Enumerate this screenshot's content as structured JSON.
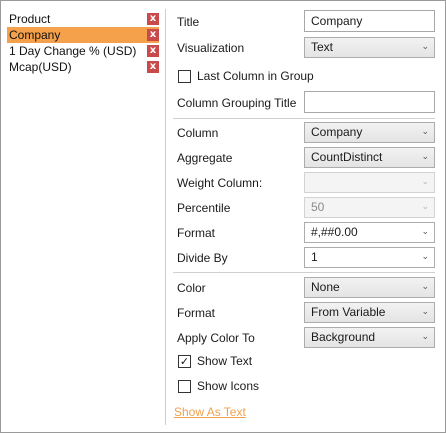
{
  "columns": [
    {
      "label": "Product",
      "selected": false
    },
    {
      "label": "Company",
      "selected": true
    },
    {
      "label": "1 Day Change % (USD)",
      "selected": false
    },
    {
      "label": "Mcap(USD)",
      "selected": false
    }
  ],
  "remove_glyph": "x",
  "title": {
    "label": "Title",
    "value": "Company"
  },
  "visualization": {
    "label": "Visualization",
    "value": "Text"
  },
  "last_column": {
    "label": "Last Column in Group",
    "checked": false
  },
  "grouping_title": {
    "label": "Column Grouping Title",
    "value": ""
  },
  "column": {
    "label": "Column",
    "value": "Company"
  },
  "aggregate": {
    "label": "Aggregate",
    "value": "CountDistinct"
  },
  "weight_column": {
    "label": "Weight Column:",
    "value": ""
  },
  "percentile": {
    "label": "Percentile",
    "value": "50"
  },
  "format": {
    "label": "Format",
    "value": "#,##0.00"
  },
  "divide_by": {
    "label": "Divide By",
    "value": "1"
  },
  "color": {
    "label": "Color",
    "value": "None"
  },
  "color_format": {
    "label": "Format",
    "value": "From Variable"
  },
  "apply_color_to": {
    "label": "Apply Color To",
    "value": "Background"
  },
  "show_text": {
    "label": "Show Text",
    "checked": true
  },
  "show_icons": {
    "label": "Show Icons",
    "checked": false
  },
  "show_as_text": {
    "label": "Show As Text"
  },
  "icons": {
    "dropdown": "chevron-down-icon",
    "check": "checkmark-icon",
    "remove": "remove-x-icon"
  },
  "colors": {
    "selected_row": "#f5a04a",
    "remove_button": "#c94a4a",
    "link": "#f0a14e"
  }
}
